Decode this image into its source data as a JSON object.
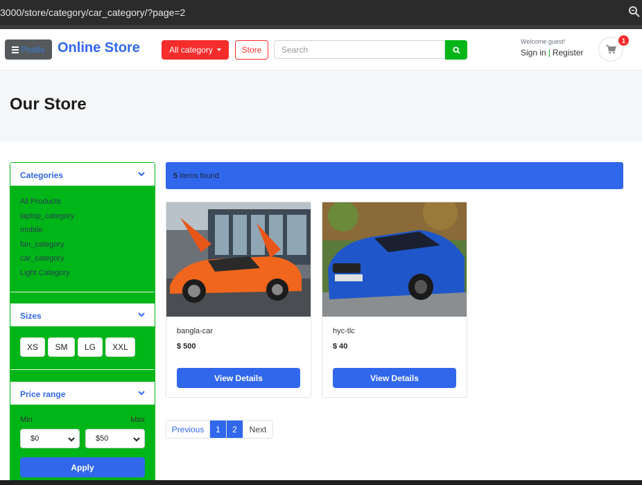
{
  "browser": {
    "url": "3000/store/category/car_category/?page=2"
  },
  "header": {
    "profile_label": "Profile",
    "logo": "Online Store",
    "all_category": "All category",
    "store": "Store",
    "search_placeholder": "Search",
    "welcome": "Welcome guest!",
    "sign_in": "Sign in",
    "register": "Register",
    "cart_count": "1"
  },
  "page_title": "Our Store",
  "sidebar": {
    "categories_title": "Categories",
    "categories": [
      "All Products",
      "laptop_category",
      "mobile",
      "fan_category",
      "car_category",
      "Light Category"
    ],
    "sizes_title": "Sizes",
    "sizes": [
      "XS",
      "SM",
      "LG",
      "XXL"
    ],
    "price_title": "Price range",
    "min_label": "Min",
    "max_label": "Max",
    "min_value": "$0",
    "max_value": "$50",
    "apply": "Apply"
  },
  "results": {
    "count": "5",
    "text": "items found"
  },
  "products": [
    {
      "name": "bangla-car",
      "price": "$ 500",
      "button": "View Details"
    },
    {
      "name": "hyc-tlc",
      "price": "$ 40",
      "button": "View Details"
    }
  ],
  "pagination": {
    "previous": "Previous",
    "pages": [
      "1",
      "2"
    ],
    "next": "Next"
  },
  "colors": {
    "primary": "#3167eb",
    "green": "#00b517",
    "red": "#f52d2d"
  }
}
